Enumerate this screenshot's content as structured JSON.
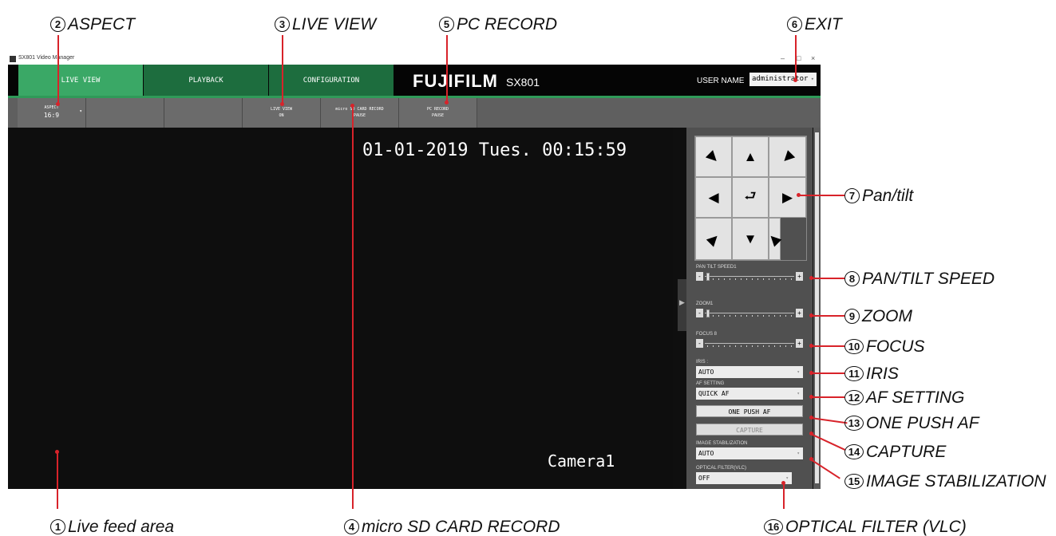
{
  "window": {
    "title": "SX801 Video Manager",
    "min": "–",
    "max": "□",
    "close": "×"
  },
  "nav": {
    "tabs": [
      {
        "label": "LIVE VIEW",
        "active": true
      },
      {
        "label": "PLAYBACK",
        "active": false
      },
      {
        "label": "CONFIGURATION",
        "active": false
      }
    ],
    "logo": "FUJIFILM",
    "model": "SX801",
    "user_label": "USER NAME",
    "user_value": "administrator"
  },
  "toolbar": {
    "aspect_label": "ASPECT",
    "aspect_value": "16:9",
    "liveview_label": "LIVE VIEW",
    "liveview_value": "ON",
    "sdrec_label": "micro SD CARD RECORD",
    "sdrec_value": "PAUSE",
    "pcrec_label": "PC RECORD",
    "pcrec_value": "PAUSE"
  },
  "feed": {
    "timestamp": "01-01-2019 Tues. 00:15:59",
    "camera": "Camera1"
  },
  "ptz": {
    "buttons": [
      "▶",
      "▲",
      "◀",
      "◀",
      "⮐",
      "▶",
      "▶",
      "▼",
      "◀"
    ],
    "pan_tilt_speed_label": "PAN TILT SPEED1",
    "pan_tilt_speed": 1,
    "zoom_label": "ZOOM1",
    "zoom": 1,
    "focus_label": "FOCUS  8",
    "focus": 8
  },
  "controls": {
    "iris_label": "IRIS :",
    "iris_value": "AUTO",
    "af_label": "AF SETTING",
    "af_value": "QUICK AF",
    "one_push_af": "ONE PUSH AF",
    "capture": "CAPTURE",
    "stab_label": "IMAGE STABILIZATION",
    "stab_value": "AUTO",
    "filter_label": "OPTICAL FILTER(VLC)",
    "filter_value": "OFF"
  },
  "callouts": {
    "c1": {
      "num": "1",
      "text": "Live feed area"
    },
    "c2": {
      "num": "2",
      "text": "ASPECT"
    },
    "c3": {
      "num": "3",
      "text": "LIVE VIEW"
    },
    "c4": {
      "num": "4",
      "text": "micro SD CARD RECORD"
    },
    "c5": {
      "num": "5",
      "text": "PC RECORD"
    },
    "c6": {
      "num": "6",
      "text": "EXIT"
    },
    "c7": {
      "num": "7",
      "text": "Pan/tilt"
    },
    "c8": {
      "num": "8",
      "text": "PAN/TILT SPEED"
    },
    "c9": {
      "num": "9",
      "text": "ZOOM"
    },
    "c10": {
      "num": "10",
      "text": "FOCUS"
    },
    "c11": {
      "num": "11",
      "text": "IRIS"
    },
    "c12": {
      "num": "12",
      "text": "AF SETTING"
    },
    "c13": {
      "num": "13",
      "text": "ONE PUSH AF"
    },
    "c14": {
      "num": "14",
      "text": "CAPTURE"
    },
    "c15": {
      "num": "15",
      "text": "IMAGE STABILIZATION"
    },
    "c16": {
      "num": "16",
      "text": "OPTICAL FILTER (VLC)"
    }
  },
  "colors": {
    "accent_green": "#3aa866",
    "callout_red": "#d8232a"
  }
}
